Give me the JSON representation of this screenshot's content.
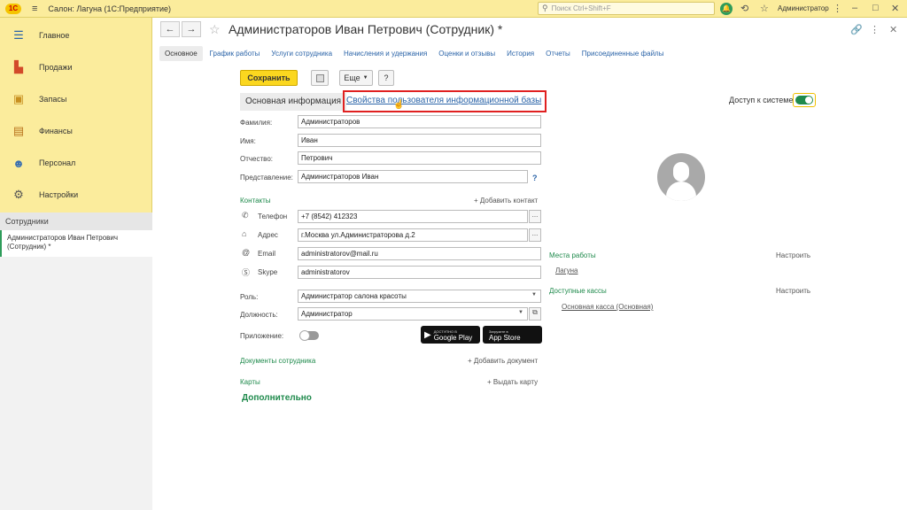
{
  "app": {
    "logo_text": "1С",
    "title": "Салон: Лагуна  (1С:Предприятие)",
    "search_placeholder": "Поиск Ctrl+Shift+F",
    "user": "Администратор"
  },
  "sidebar": {
    "items": [
      {
        "label": "Главное",
        "icon": "menu-list-icon",
        "color": "#2b64a8"
      },
      {
        "label": "Продажи",
        "icon": "bar-chart-icon",
        "color": "#d24a2a"
      },
      {
        "label": "Запасы",
        "icon": "box-icon",
        "color": "#c89020"
      },
      {
        "label": "Финансы",
        "icon": "wallet-icon",
        "color": "#b8721c"
      },
      {
        "label": "Персонал",
        "icon": "people-icon",
        "color": "#3a6fb0"
      },
      {
        "label": "Настройки",
        "icon": "gear-icon",
        "color": "#555555"
      }
    ],
    "open_header": "Сотрудники",
    "open_item": "Администраторов Иван Петрович (Сотрудник) *"
  },
  "header": {
    "title": "Администраторов Иван Петрович (Сотрудник) *"
  },
  "tabs": [
    "Основное",
    "График работы",
    "Услуги сотрудника",
    "Начисления и удержания",
    "Оценки и отзывы",
    "История",
    "Отчеты",
    "Присоединенные файлы"
  ],
  "toolbar": {
    "save_label": "Сохранить",
    "more_label": "Еще",
    "help_label": "?"
  },
  "section": {
    "tab_label": "Основная информация",
    "link_label": "Свойства пользователя информационной базы",
    "access_label": "Доступ к системе:"
  },
  "fields": {
    "surname_label": "Фамилия:",
    "surname": "Администраторов",
    "name_label": "Имя:",
    "name": "Иван",
    "patronymic_label": "Отчество:",
    "patronymic": "Петрович",
    "display_label": "Представление:",
    "display": "Администраторов Иван"
  },
  "contacts": {
    "title": "Контакты",
    "add": "+ Добавить контакт",
    "phone_label": "Телефон",
    "phone": "+7 (8542) 412323",
    "address_label": "Адрес",
    "address": "г.Москва ул.Администраторова д.2",
    "email_label": "Email",
    "email": "administratorov@mail.ru",
    "skype_label": "Skype",
    "skype": "administratorov"
  },
  "role": {
    "role_label": "Роль:",
    "role": "Администратор салона красоты",
    "position_label": "Должность:",
    "position": "Администратор",
    "app_label": "Приложение:"
  },
  "stores": {
    "google_small": "ДОСТУПНО В",
    "google": "Google Play",
    "apple_small": "Загрузите в",
    "apple": "App Store"
  },
  "workplaces": {
    "title": "Места работы",
    "configure": "Настроить",
    "item": "Лагуна"
  },
  "cashboxes": {
    "title": "Доступные кассы",
    "configure": "Настроить",
    "item": "Основная касса  (Основная)"
  },
  "documents": {
    "title": "Документы сотрудника",
    "add": "+ Добавить документ"
  },
  "cards": {
    "title": "Карты",
    "add": "+ Выдать карту"
  },
  "extra": {
    "title": "Дополнительно"
  }
}
